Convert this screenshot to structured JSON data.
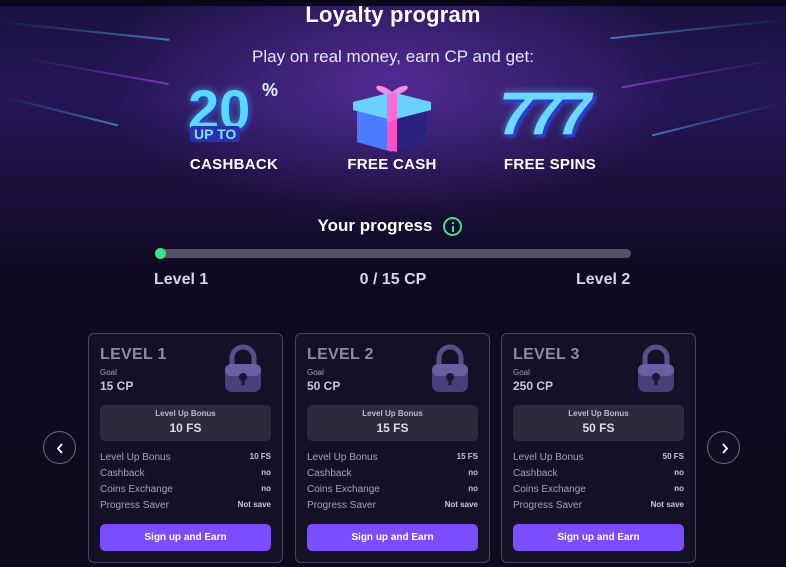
{
  "page": {
    "title": "Loyalty program",
    "subtitle": "Play on real money, earn CP and get:"
  },
  "perks": [
    {
      "label": "CASHBACK",
      "art_text": "20",
      "art_sub": "UP TO",
      "art_sup": "%",
      "icon": "cashback-20-percent-icon"
    },
    {
      "label": "FREE CASH",
      "icon": "gift-box-icon"
    },
    {
      "label": "FREE SPINS",
      "art_text": "777",
      "icon": "slot-777-icon"
    }
  ],
  "progress": {
    "title": "Your progress",
    "current_level": "Level 1",
    "next_level": "Level 2",
    "points_text": "0 / 15 CP",
    "fraction": 0.0,
    "accent": "#3be08a"
  },
  "levels": [
    {
      "name": "LEVEL 1",
      "goal_label": "Goal",
      "goal": "15 CP",
      "bonus_label": "Level Up Bonus",
      "bonus_value": "10 FS",
      "rows": [
        {
          "key": "Level Up Bonus",
          "value": "10 FS"
        },
        {
          "key": "Cashback",
          "value": "no"
        },
        {
          "key": "Coins Exchange",
          "value": "no"
        },
        {
          "key": "Progress Saver",
          "value": "Not save"
        }
      ],
      "cta": "Sign up and Earn"
    },
    {
      "name": "LEVEL 2",
      "goal_label": "Goal",
      "goal": "50 CP",
      "bonus_label": "Level Up Bonus",
      "bonus_value": "15 FS",
      "rows": [
        {
          "key": "Level Up Bonus",
          "value": "15 FS"
        },
        {
          "key": "Cashback",
          "value": "no"
        },
        {
          "key": "Coins Exchange",
          "value": "no"
        },
        {
          "key": "Progress Saver",
          "value": "Not save"
        }
      ],
      "cta": "Sign up and Earn"
    },
    {
      "name": "LEVEL 3",
      "goal_label": "Goal",
      "goal": "250 CP",
      "bonus_label": "Level Up Bonus",
      "bonus_value": "50 FS",
      "rows": [
        {
          "key": "Level Up Bonus",
          "value": "50 FS"
        },
        {
          "key": "Cashback",
          "value": "no"
        },
        {
          "key": "Coins Exchange",
          "value": "no"
        },
        {
          "key": "Progress Saver",
          "value": "Not save"
        }
      ],
      "cta": "Sign up and Earn"
    }
  ],
  "nav": {
    "prev_icon": "chevron-left-icon",
    "next_icon": "chevron-right-icon"
  },
  "colors": {
    "cta": "#7b4dff",
    "accent": "#3be08a",
    "card_bg": "#141126"
  }
}
